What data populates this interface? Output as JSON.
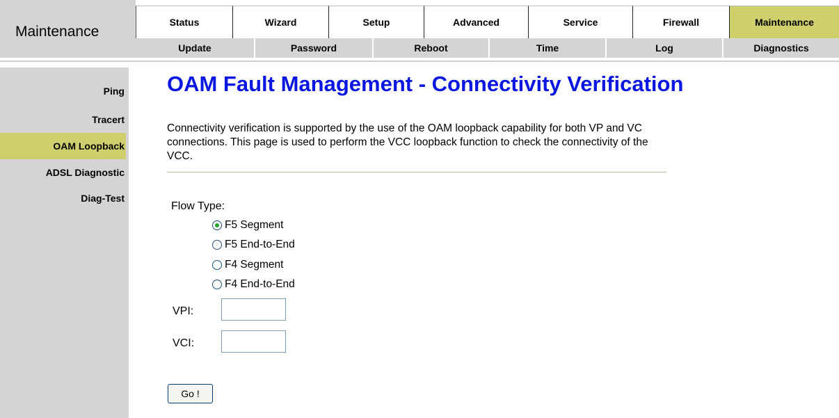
{
  "brand": {
    "title": "Maintenance"
  },
  "nav": {
    "primary_tabs": [
      {
        "label": "Status",
        "active": false
      },
      {
        "label": "Wizard",
        "active": false
      },
      {
        "label": "Setup",
        "active": false
      },
      {
        "label": "Advanced",
        "active": false
      },
      {
        "label": "Service",
        "active": false
      },
      {
        "label": "Firewall",
        "active": false
      },
      {
        "label": "Maintenance",
        "active": true
      }
    ],
    "secondary_tabs": [
      {
        "label": "Update"
      },
      {
        "label": "Password"
      },
      {
        "label": "Reboot"
      },
      {
        "label": "Time"
      },
      {
        "label": "Log"
      },
      {
        "label": "Diagnostics"
      }
    ]
  },
  "sidebar": {
    "items": [
      {
        "label": "Ping",
        "active": false
      },
      {
        "label": "Tracert",
        "active": false
      },
      {
        "label": "OAM Loopback",
        "active": true
      },
      {
        "label": "ADSL Diagnostic",
        "active": false
      },
      {
        "label": "Diag-Test",
        "active": false
      }
    ]
  },
  "main": {
    "title": "OAM Fault Management - Connectivity Verification",
    "description": "Connectivity verification is supported by the use of the OAM loopback capability for both VP and VC connections. This page is used to perform the VCC loopback function to check the connectivity of the VCC.",
    "flow_type": {
      "label": "Flow Type:",
      "options": [
        {
          "label": "F5 Segment",
          "checked": true
        },
        {
          "label": "F5 End-to-End",
          "checked": false
        },
        {
          "label": "F4 Segment",
          "checked": false
        },
        {
          "label": "F4 End-to-End",
          "checked": false
        }
      ]
    },
    "vpi": {
      "label": "VPI:",
      "value": ""
    },
    "vci": {
      "label": "VCI:",
      "value": ""
    },
    "go_label": "Go !"
  },
  "colors": {
    "accent": "#cfcf6d",
    "title_blue": "#0a17e0",
    "panel_gray": "#d4d4d4"
  }
}
